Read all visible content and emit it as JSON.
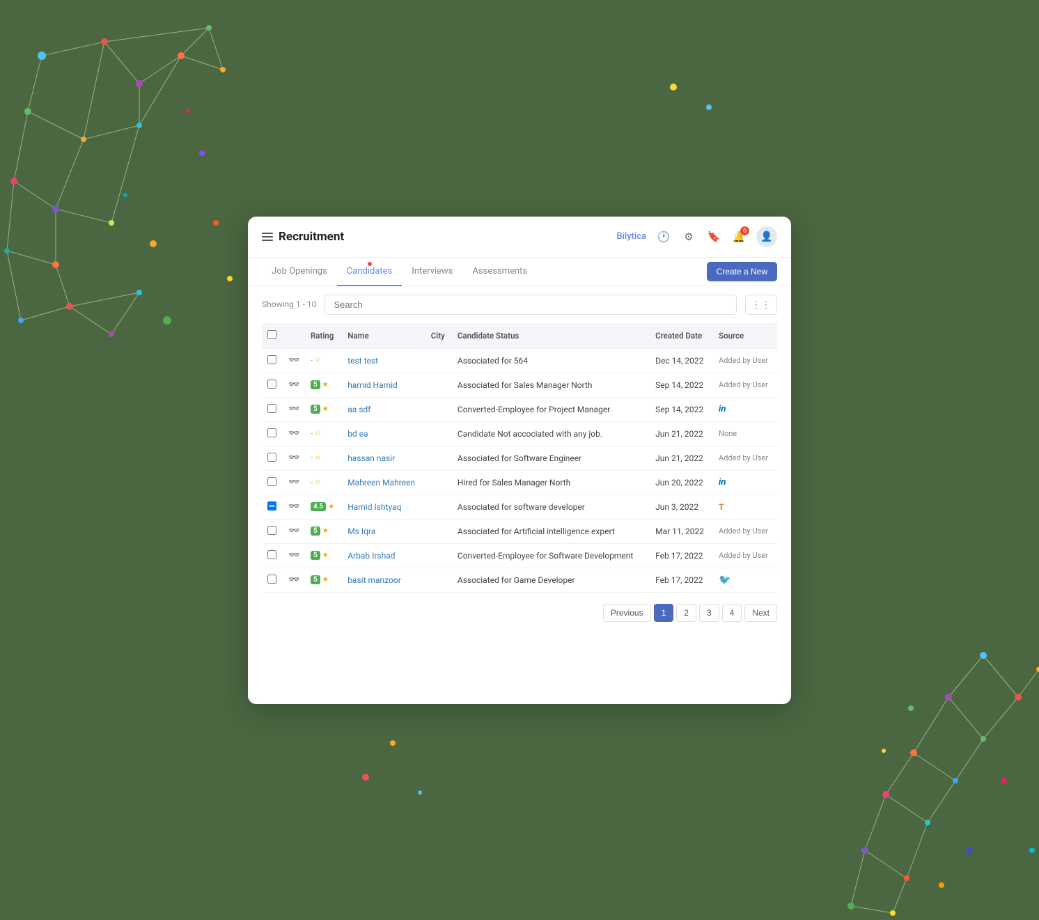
{
  "app": {
    "title": "Recruitment",
    "brand": "Bilytica"
  },
  "nav": {
    "tabs": [
      {
        "id": "job-openings",
        "label": "Job Openings",
        "active": false
      },
      {
        "id": "candidates",
        "label": "Candidates",
        "active": true
      },
      {
        "id": "interviews",
        "label": "Interviews",
        "active": false
      },
      {
        "id": "assessments",
        "label": "Assessments",
        "active": false
      }
    ],
    "create_button": "Create a New"
  },
  "toolbar": {
    "showing": "Showing 1 - 10",
    "search_placeholder": "Search"
  },
  "table": {
    "columns": [
      "",
      "",
      "Rating",
      "Name",
      "City",
      "Candidate Status",
      "Created Date",
      "Source"
    ],
    "rows": [
      {
        "rating": "-",
        "name": "test test",
        "city": "",
        "status": "Associated for 564",
        "date": "Dec 14, 2022",
        "source": "Added by User",
        "source_type": "text"
      },
      {
        "rating": "5",
        "name": "hamid Hamid",
        "city": "",
        "status": "Associated for Sales Manager North",
        "date": "Sep 14, 2022",
        "source": "Added by User",
        "source_type": "text"
      },
      {
        "rating": "5",
        "name": "aa sdf",
        "city": "",
        "status": "Converted-Employee for Project Manager",
        "date": "Sep 14, 2022",
        "source": "in",
        "source_type": "linkedin"
      },
      {
        "rating": "-",
        "name": "bd ea",
        "city": "",
        "status": "Candidate Not accociated with any job.",
        "date": "Jun 21, 2022",
        "source": "None",
        "source_type": "text"
      },
      {
        "rating": "-",
        "name": "hassan nasir",
        "city": "",
        "status": "Associated for Software Engineer",
        "date": "Jun 21, 2022",
        "source": "Added by User",
        "source_type": "text"
      },
      {
        "rating": "-",
        "name": "Mahreen Mahreen",
        "city": "",
        "status": "Hired for Sales Manager North",
        "date": "Jun 20, 2022",
        "source": "in",
        "source_type": "linkedin"
      },
      {
        "rating": "4.5",
        "name": "Hamid Ishtyaq",
        "city": "",
        "status": "Associated for software developer",
        "date": "Jun 3, 2022",
        "source": "T",
        "source_type": "taleo"
      },
      {
        "rating": "5",
        "name": "Ms Iqra",
        "city": "",
        "status": "Associated for Artificial intelligence expert",
        "date": "Mar 11, 2022",
        "source": "Added by User",
        "source_type": "text"
      },
      {
        "rating": "5",
        "name": "Arbab Irshad",
        "city": "",
        "status": "Converted-Employee for Software Development",
        "date": "Feb 17, 2022",
        "source": "Added by User",
        "source_type": "text"
      },
      {
        "rating": "5",
        "name": "basit manzoor",
        "city": "",
        "status": "Associated for Game Developer",
        "date": "Feb 17, 2022",
        "source": "twitter",
        "source_type": "twitter"
      }
    ]
  },
  "pagination": {
    "previous": "Previous",
    "next": "Next",
    "pages": [
      "1",
      "2",
      "3",
      "4"
    ],
    "active_page": "1"
  }
}
